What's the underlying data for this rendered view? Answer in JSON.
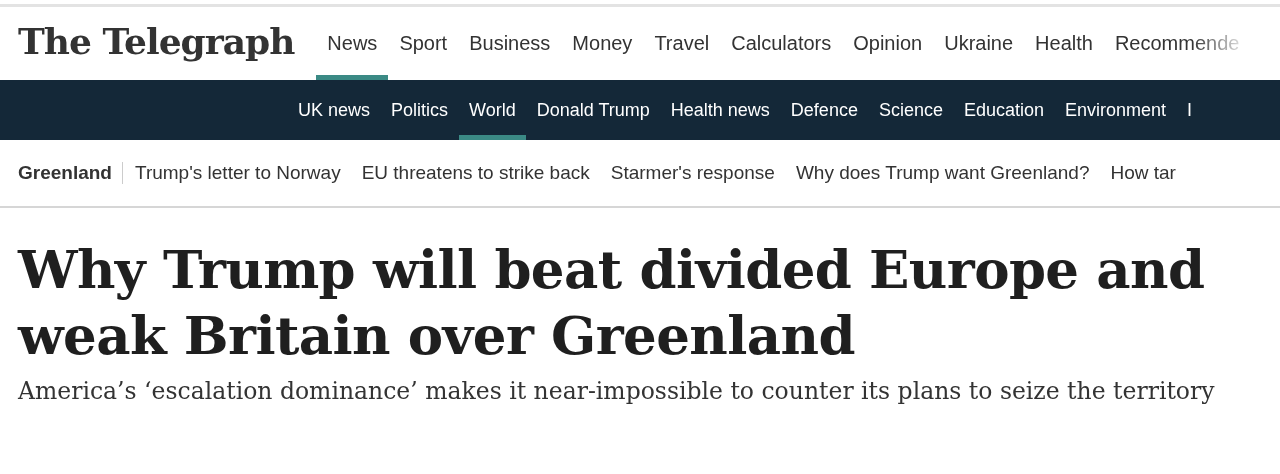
{
  "masthead": {
    "logo": "The Telegraph"
  },
  "main_nav": [
    {
      "label": "News",
      "selected": true
    },
    {
      "label": "Sport",
      "selected": false
    },
    {
      "label": "Business",
      "selected": false
    },
    {
      "label": "Money",
      "selected": false
    },
    {
      "label": "Travel",
      "selected": false
    },
    {
      "label": "Calculators",
      "selected": false
    },
    {
      "label": "Opinion",
      "selected": false
    },
    {
      "label": "Ukraine",
      "selected": false
    },
    {
      "label": "Health",
      "selected": false
    },
    {
      "label": "Recommende",
      "selected": false
    }
  ],
  "section_nav": [
    {
      "label": "UK news",
      "selected": false
    },
    {
      "label": "Politics",
      "selected": false
    },
    {
      "label": "World",
      "selected": true
    },
    {
      "label": "Donald Trump",
      "selected": false
    },
    {
      "label": "Health news",
      "selected": false
    },
    {
      "label": "Defence",
      "selected": false
    },
    {
      "label": "Science",
      "selected": false
    },
    {
      "label": "Education",
      "selected": false
    },
    {
      "label": "Environment",
      "selected": false
    },
    {
      "label": "I",
      "selected": false
    }
  ],
  "topic_bar": {
    "title": "Greenland",
    "links": [
      "Trump's letter to Norway",
      "EU threatens to strike back",
      "Starmer's response",
      "Why does Trump want Greenland?",
      "How tar"
    ]
  },
  "article": {
    "headline": "Why Trump will beat divided Europe and weak Britain over Greenland",
    "standfirst": "America’s ‘escalation dominance’ makes it near-impossible to counter its plans to seize the territory"
  }
}
